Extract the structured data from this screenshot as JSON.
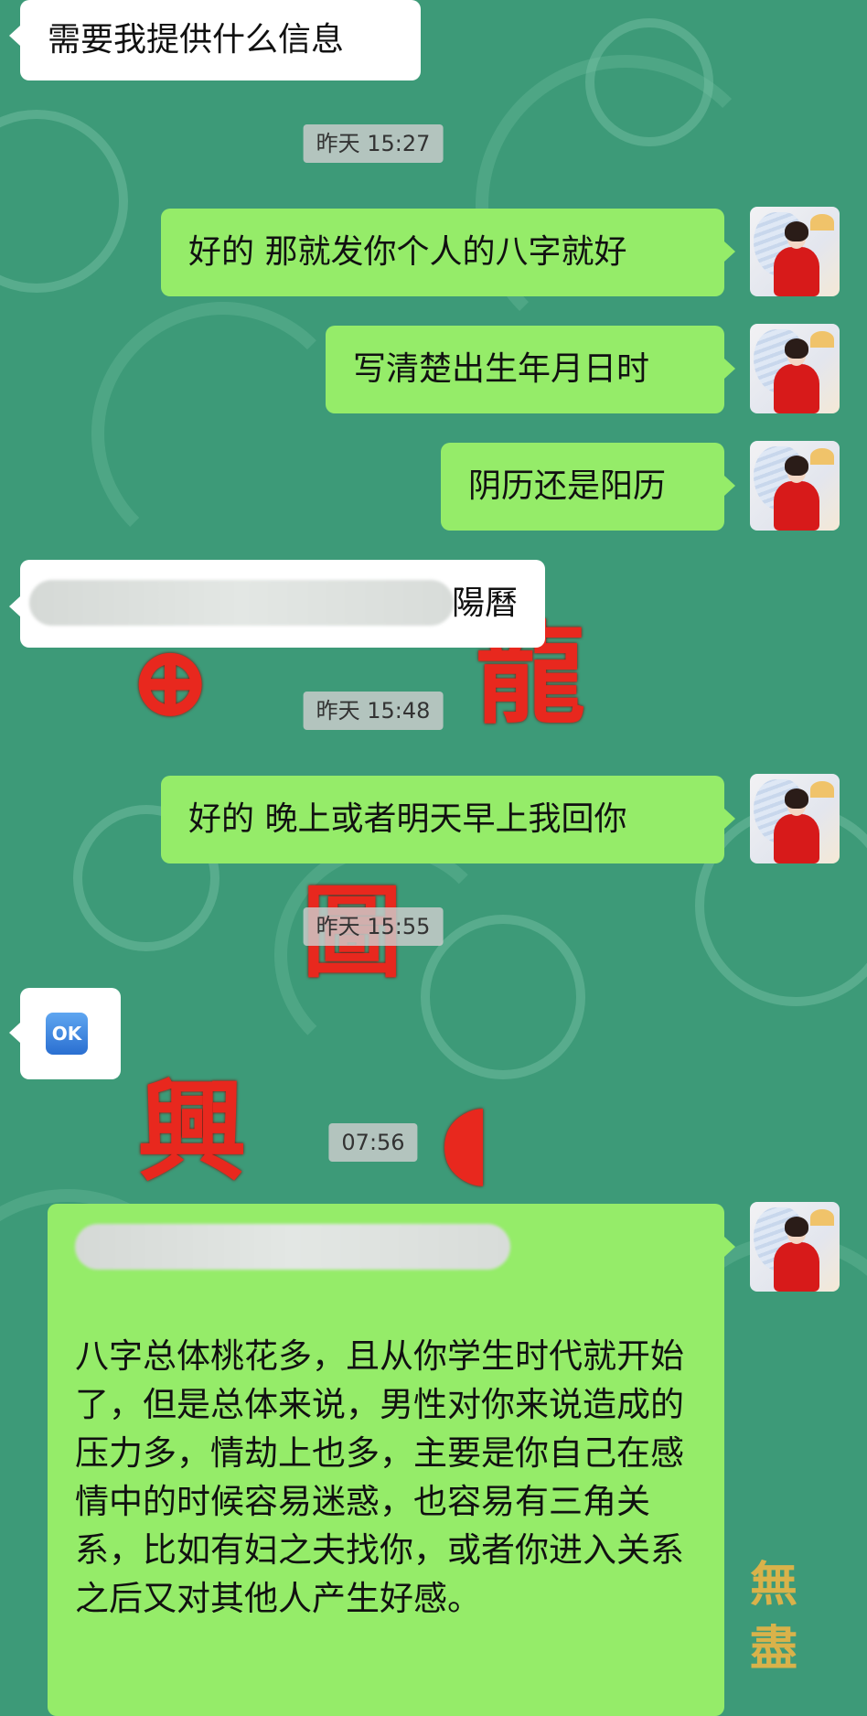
{
  "messages": [
    {
      "text": "需要我提供什么信息"
    },
    {
      "text": "好的 那就发你个人的八字就好"
    },
    {
      "text": "写清楚出生年月日时"
    },
    {
      "text": "阴历还是阳历"
    },
    {
      "text": "陽曆"
    },
    {
      "text": "好的 晚上或者明天早上我回你"
    },
    {
      "text": "OK"
    },
    {
      "text": "八字总体桃花多，且从你学生时代就开始了，但是总体来说，男性对你来说造成的压力多，情劫上也多，主要是你自己在感情中的时候容易迷惑，也容易有三角关系，比如有妇之夫找你，或者你进入关系之后又对其他人产生好感。"
    }
  ],
  "timestamps": [
    "昨天 15:27",
    "昨天 15:48",
    "昨天 15:55",
    "07:56"
  ],
  "colors": {
    "background": "#3d9a78",
    "outgoing_bubble": "#95ec69",
    "incoming_bubble": "#ffffff"
  },
  "icons": {
    "ok": "ok-emoji-icon",
    "avatar": "contact-avatar"
  }
}
